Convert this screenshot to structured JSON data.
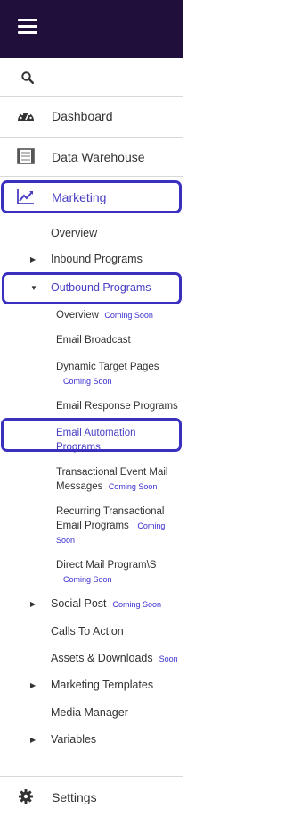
{
  "header": {
    "menu_icon": "hamburger-icon"
  },
  "search": {
    "icon": "search-icon"
  },
  "nav": {
    "dashboard": "Dashboard",
    "data_warehouse": "Data Warehouse",
    "marketing": "Marketing",
    "settings": "Settings"
  },
  "marketing": {
    "overview": "Overview",
    "inbound": "Inbound Programs",
    "outbound": "Outbound Programs",
    "outbound_items": {
      "overview": "Overview",
      "email_broadcast": "Email Broadcast",
      "dynamic_target_pages": "Dynamic Target Pages",
      "email_response": "Email Response Programs",
      "email_automation_1": "Email Automation",
      "email_automation_2": "Programs",
      "transactional_1": "Transactional Event Mail",
      "transactional_2": "Messages",
      "recurring_1": "Recurring Transactional",
      "recurring_2": "Email Programs",
      "direct_mail": "Direct Mail Program\\S"
    },
    "social_post": "Social Post",
    "calls_to_action": "Calls To Action",
    "assets_downloads": "Assets & Downloads",
    "marketing_templates": "Marketing Templates",
    "media_manager": "Media Manager",
    "variables": "Variables"
  },
  "badges": {
    "coming_soon": "Coming Soon",
    "coming": "Coming",
    "soon": "Soon"
  },
  "colors": {
    "header_bg": "#1f0f3a",
    "accent": "#4a3fc4",
    "highlight_border": "#3a2fbf"
  }
}
